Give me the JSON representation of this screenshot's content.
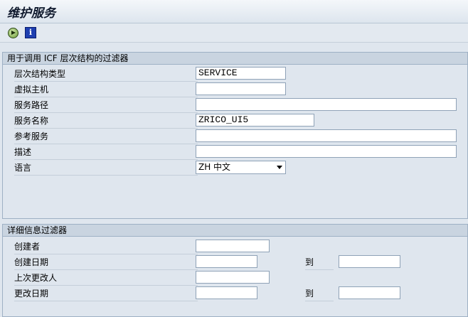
{
  "window": {
    "title": "维护服务"
  },
  "toolbar": {
    "execute_icon": "execute-icon",
    "info_icon": "info-icon",
    "info_glyph": "i"
  },
  "icf_filter": {
    "heading": "用于调用 ICF 层次结构的过滤器",
    "fields": [
      {
        "label": "层次结构类型",
        "value": "SERVICE"
      },
      {
        "label": "虚拟主机",
        "value": ""
      },
      {
        "label": "服务路径",
        "value": ""
      },
      {
        "label": "服务名称",
        "value": "ZRICO_UI5"
      },
      {
        "label": "参考服务",
        "value": ""
      },
      {
        "label": "描述",
        "value": ""
      },
      {
        "label": "语言",
        "value": "ZH 中文"
      }
    ]
  },
  "detail_filter": {
    "heading": "详细信息过滤器",
    "to_label": "到",
    "fields": [
      {
        "label": "创建者",
        "value": ""
      },
      {
        "label": "创建日期",
        "value": "",
        "to_value": ""
      },
      {
        "label": "上次更改人",
        "value": ""
      },
      {
        "label": "更改日期",
        "value": "",
        "to_value": ""
      }
    ]
  }
}
